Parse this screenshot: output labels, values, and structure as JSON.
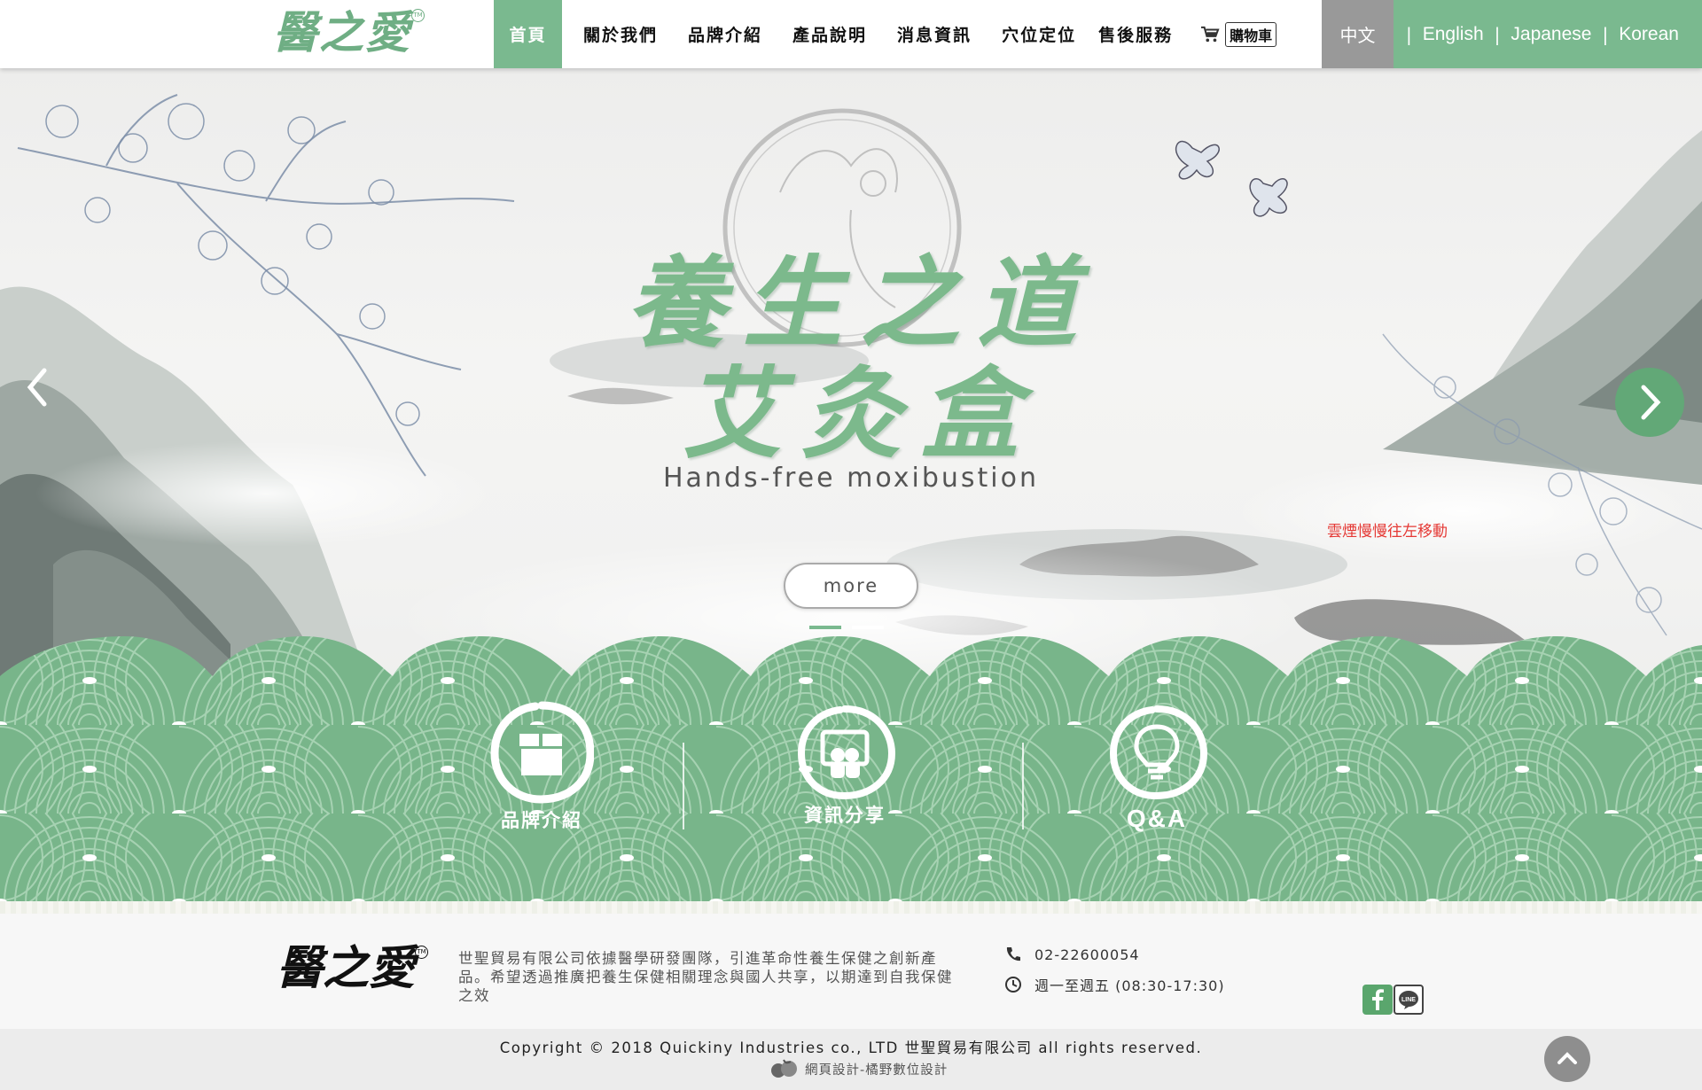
{
  "header": {
    "logo_text": "醫之愛",
    "logo_tm": "TM",
    "nav": [
      {
        "label": "首頁",
        "active": true
      },
      {
        "label": "關於我們"
      },
      {
        "label": "品牌介紹"
      },
      {
        "label": "產品說明"
      },
      {
        "label": "消息資訊"
      },
      {
        "label": "穴位定位"
      },
      {
        "label": "售後服務"
      }
    ],
    "cart_label": "購物車",
    "cart_icon": "cart-icon",
    "languages": {
      "current": "中文",
      "others": [
        "English",
        "Japanese",
        "Korean"
      ]
    }
  },
  "hero": {
    "title_line1": "養生之道",
    "title_line2": "艾灸盒",
    "subtitle": "Hands-free moxibustion",
    "note": "雲煙慢慢往左移動",
    "more_label": "more",
    "slide_count": 2,
    "active_slide": 1
  },
  "features": [
    {
      "label": "品牌介紹",
      "icon": "box-icon"
    },
    {
      "label": "資訊分享",
      "icon": "share-icon"
    },
    {
      "label": "Q&A",
      "icon": "lightbulb-icon"
    }
  ],
  "footer": {
    "logo_text": "醫之愛",
    "logo_tm": "TM",
    "description": "世聖貿易有限公司依據醫學研發團隊，引進革命性養生保健之創新產品。希望透過推廣把養生保健相關理念與國人共享，以期達到自我保健之效",
    "phone": "02-22600054",
    "hours": "週一至週五 (08:30-17:30)",
    "social": [
      "facebook-icon",
      "line-icon"
    ],
    "copyright": "Copyright © 2018 Quickiny Industries co., LTD 世聖貿易有限公司 all rights reserved.",
    "designer": "網頁設計-橘野數位設計"
  },
  "colors": {
    "brand_green": "#7ab98f",
    "dark_green": "#62a877",
    "language_gray": "#999999",
    "note_red": "#e53935"
  }
}
